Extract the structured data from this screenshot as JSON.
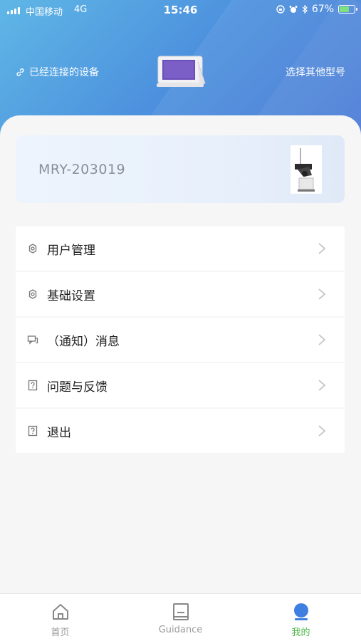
{
  "status_bar": {
    "carrier": "中国移动",
    "network": "4G",
    "time": "15:46",
    "battery_percent": "67%",
    "battery_level": 0.67
  },
  "header": {
    "connected_label": "已经连接的设备",
    "select_model_label": "选择其他型号"
  },
  "device_card": {
    "model": "MRY-203019"
  },
  "menu": {
    "items": [
      {
        "label": "用户管理",
        "icon": "gear-icon"
      },
      {
        "label": "基础设置",
        "icon": "gear-icon"
      },
      {
        "label": "（通知）消息",
        "icon": "message-icon"
      },
      {
        "label": "问题与反馈",
        "icon": "question-icon"
      },
      {
        "label": "退出",
        "icon": "question-icon"
      }
    ]
  },
  "tabbar": {
    "tabs": [
      {
        "label": "首页",
        "icon": "home-icon",
        "active": false
      },
      {
        "label": "Guidance",
        "icon": "book-icon",
        "active": false
      },
      {
        "label": "我的",
        "icon": "profile-icon",
        "active": true
      }
    ]
  },
  "colors": {
    "header_start": "#5fb7e6",
    "header_end": "#3f70d4",
    "active_tab": "#4cb848",
    "battery_fill": "#7ee07e"
  }
}
